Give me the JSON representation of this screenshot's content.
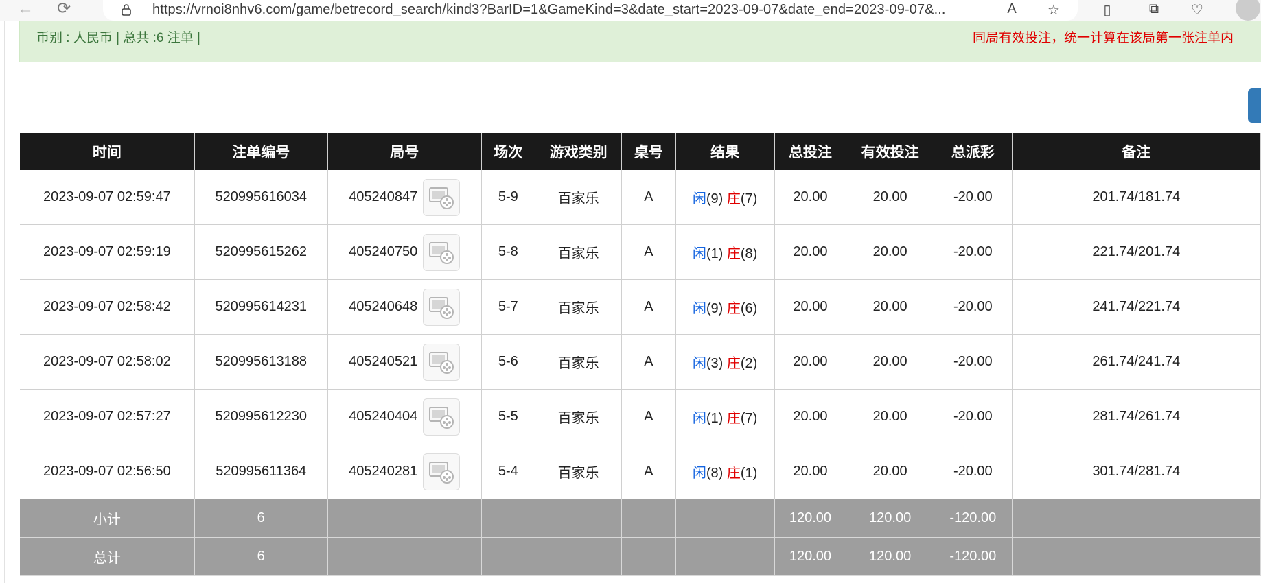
{
  "browser": {
    "url": "https://vrnoi8nhv6.com/game/betrecord_search/kind3?BarID=1&GameKind=3&date_start=2023-09-07&date_end=2023-09-07&..."
  },
  "banner": {
    "summary": "币别 : 人民币 | 总共 :6 注单 |",
    "notice": "同局有效投注，统一计算在该局第一张注单内"
  },
  "table": {
    "headers": [
      "时间",
      "注单编号",
      "局号",
      "场次",
      "游戏类别",
      "桌号",
      "结果",
      "总投注",
      "有效投注",
      "总派彩",
      "备注"
    ],
    "rows": [
      {
        "time": "2023-09-07 02:59:47",
        "bet_id": "520995616034",
        "round": "405240847",
        "session": "5-9",
        "game": "百家乐",
        "table": "A",
        "player_label": "闲",
        "player_score": "(9)",
        "banker_label": "庄",
        "banker_score": "(7)",
        "total_bet": "20.00",
        "valid_bet": "20.00",
        "payout": "-20.00",
        "remark": "201.74/181.74"
      },
      {
        "time": "2023-09-07 02:59:19",
        "bet_id": "520995615262",
        "round": "405240750",
        "session": "5-8",
        "game": "百家乐",
        "table": "A",
        "player_label": "闲",
        "player_score": "(1)",
        "banker_label": "庄",
        "banker_score": "(8)",
        "total_bet": "20.00",
        "valid_bet": "20.00",
        "payout": "-20.00",
        "remark": "221.74/201.74"
      },
      {
        "time": "2023-09-07 02:58:42",
        "bet_id": "520995614231",
        "round": "405240648",
        "session": "5-7",
        "game": "百家乐",
        "table": "A",
        "player_label": "闲",
        "player_score": "(9)",
        "banker_label": "庄",
        "banker_score": "(6)",
        "total_bet": "20.00",
        "valid_bet": "20.00",
        "payout": "-20.00",
        "remark": "241.74/221.74"
      },
      {
        "time": "2023-09-07 02:58:02",
        "bet_id": "520995613188",
        "round": "405240521",
        "session": "5-6",
        "game": "百家乐",
        "table": "A",
        "player_label": "闲",
        "player_score": "(3)",
        "banker_label": "庄",
        "banker_score": "(2)",
        "total_bet": "20.00",
        "valid_bet": "20.00",
        "payout": "-20.00",
        "remark": "261.74/241.74"
      },
      {
        "time": "2023-09-07 02:57:27",
        "bet_id": "520995612230",
        "round": "405240404",
        "session": "5-5",
        "game": "百家乐",
        "table": "A",
        "player_label": "闲",
        "player_score": "(1)",
        "banker_label": "庄",
        "banker_score": "(7)",
        "total_bet": "20.00",
        "valid_bet": "20.00",
        "payout": "-20.00",
        "remark": "281.74/261.74"
      },
      {
        "time": "2023-09-07 02:56:50",
        "bet_id": "520995611364",
        "round": "405240281",
        "session": "5-4",
        "game": "百家乐",
        "table": "A",
        "player_label": "闲",
        "player_score": "(8)",
        "banker_label": "庄",
        "banker_score": "(1)",
        "total_bet": "20.00",
        "valid_bet": "20.00",
        "payout": "-20.00",
        "remark": "301.74/281.74"
      }
    ],
    "subtotal": {
      "label": "小计",
      "count": "6",
      "total_bet": "120.00",
      "valid_bet": "120.00",
      "payout": "-120.00"
    },
    "grand_total": {
      "label": "总计",
      "count": "6",
      "total_bet": "120.00",
      "valid_bet": "120.00",
      "payout": "-120.00"
    }
  },
  "colors": {
    "header_bg": "#1a1a1a",
    "banner_bg": "#dff0d8",
    "player": "#1565e0",
    "banker": "#e00000",
    "summary_bg": "#9e9e9e"
  }
}
